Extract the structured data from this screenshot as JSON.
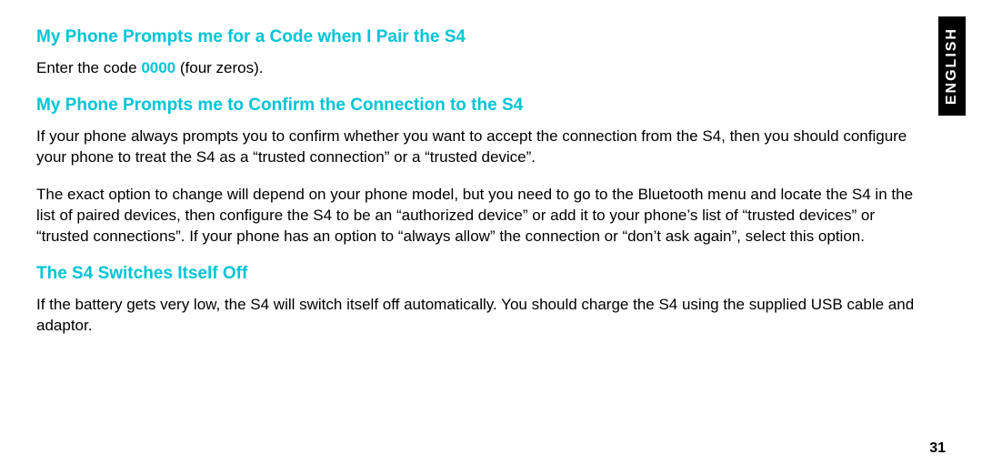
{
  "sideTab": "ENGLISH",
  "pageNumber": "31",
  "sections": {
    "s1": {
      "heading": "My Phone Prompts me for a Code when I Pair the S4",
      "p1_a": "Enter the code ",
      "p1_code": "0000",
      "p1_b": " (four zeros)."
    },
    "s2": {
      "heading": "My Phone Prompts me to Confirm the Connection to the S4",
      "p1": "If your phone always prompts you to confirm whether you want to accept the connection from the S4, then you should configure your phone to treat the S4 as a “trusted connection” or a “trusted device”.",
      "p2": "The exact option to change will depend on your phone model, but you need to go to the Bluetooth menu and locate the S4 in the list of paired devices, then configure the S4 to be an “authorized device” or add it to your phone’s list of “trusted devices” or “trusted connections”. If your phone has an option to “always allow” the connection or “don’t ask again”, select this option."
    },
    "s3": {
      "heading": "The S4 Switches Itself Off",
      "p1": "If the battery gets very low, the S4 will switch itself off automatically. You should charge the S4 using the supplied USB cable and adaptor."
    }
  }
}
